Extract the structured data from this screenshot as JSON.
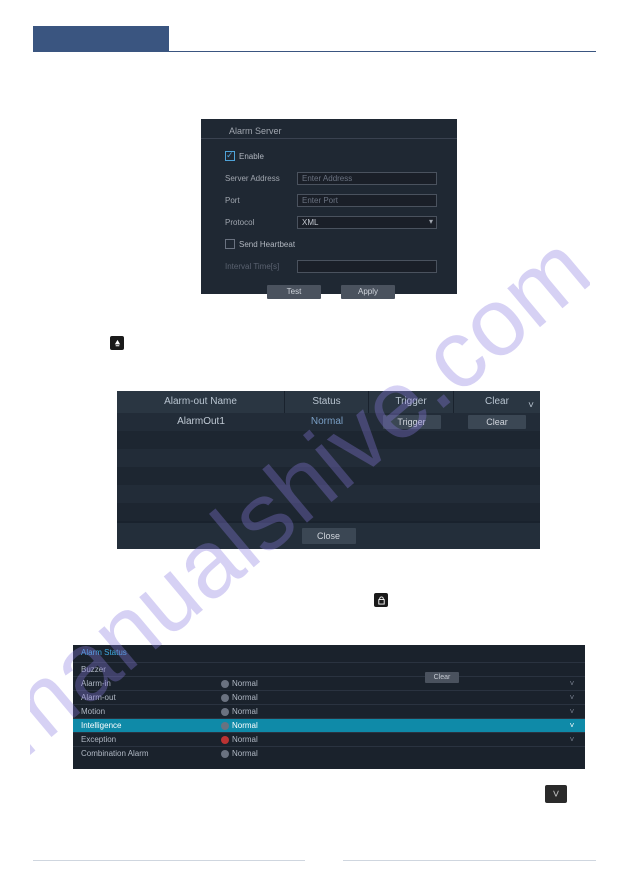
{
  "figure1": {
    "title": "Alarm Server",
    "enable_label": "Enable",
    "server_address_label": "Server Address",
    "server_address_placeholder": "Enter Address",
    "port_label": "Port",
    "port_placeholder": "Enter Port",
    "protocol_label": "Protocol",
    "protocol_value": "XML",
    "send_heartbeat_label": "Send Heartbeat",
    "interval_label": "Interval Time[s]",
    "test_btn": "Test",
    "apply_btn": "Apply"
  },
  "figure2": {
    "headers": {
      "name": "Alarm-out Name",
      "status": "Status",
      "trigger": "Trigger",
      "clear": "Clear"
    },
    "row": {
      "name": "AlarmOut1",
      "status": "Normal",
      "trigger_btn": "Trigger",
      "clear_btn": "Clear"
    },
    "close_btn": "Close"
  },
  "figure3": {
    "tab": "Alarm Status",
    "clear_btn": "Clear",
    "rows": [
      {
        "label": "Buzzer",
        "status": ""
      },
      {
        "label": "Alarm-in",
        "status": "Normal"
      },
      {
        "label": "Alarm-out",
        "status": "Normal"
      },
      {
        "label": "Motion",
        "status": "Normal"
      },
      {
        "label": "Intelligence",
        "status": "Normal"
      },
      {
        "label": "Exception",
        "status": "Normal"
      },
      {
        "label": "Combination Alarm",
        "status": "Normal"
      }
    ]
  }
}
